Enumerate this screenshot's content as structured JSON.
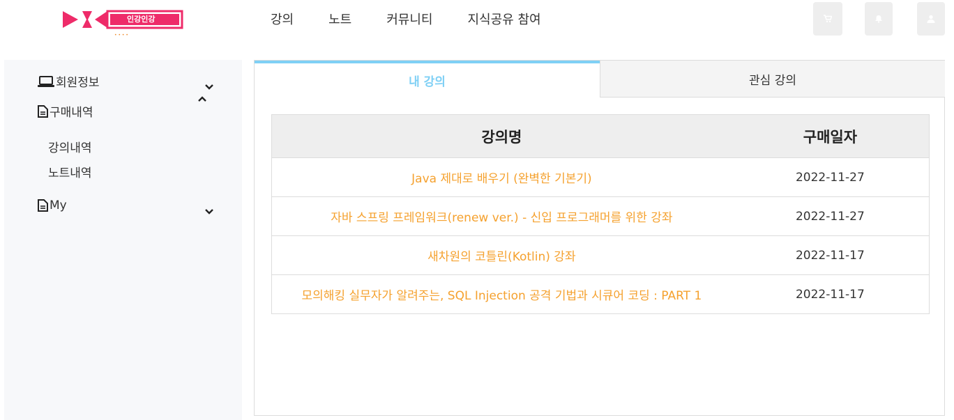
{
  "colors": {
    "accent": "#7fd0f5",
    "link": "#f5a12e",
    "brand": "#ee2b69"
  },
  "logo": {
    "badge_text": "인강인강",
    "dots": "• • • •"
  },
  "nav": {
    "items": [
      "강의",
      "노트",
      "커뮤니티",
      "지식공유 참여"
    ]
  },
  "header_buttons": {
    "icons": [
      "cart-icon",
      "bell-icon",
      "user-icon"
    ]
  },
  "sidebar": {
    "member_info": "회원정보",
    "purchase_history": "구매내역",
    "sub_items": [
      "강의내역",
      "노트내역"
    ],
    "my": "My"
  },
  "tabs": {
    "active": "내 강의",
    "inactive": "관심 강의"
  },
  "table": {
    "headers": [
      "강의명",
      "구매일자"
    ],
    "rows": [
      {
        "title": "Java 제대로 배우기 (완벽한 기본기)",
        "date": "2022-11-27"
      },
      {
        "title": "자바 스프링 프레임워크(renew ver.) - 신입 프로그래머를 위한 강좌",
        "date": "2022-11-27"
      },
      {
        "title": "새차원의 코틀린(Kotlin) 강좌",
        "date": "2022-11-17"
      },
      {
        "title": "모의해킹 실무자가 알려주는, SQL Injection 공격 기법과 시큐어 코딩 : PART 1",
        "date": "2022-11-17"
      }
    ]
  }
}
